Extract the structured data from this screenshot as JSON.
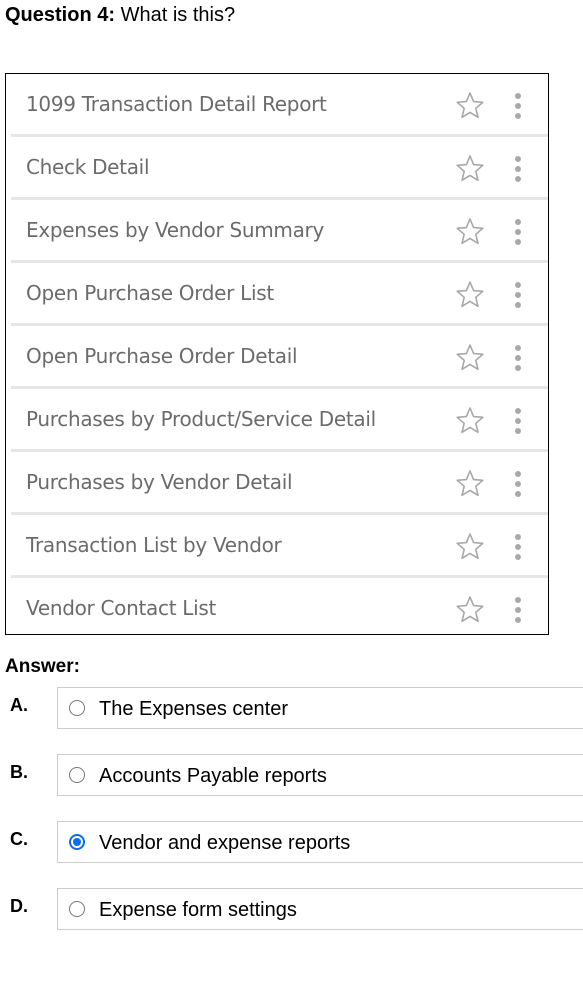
{
  "question": {
    "number_label": "Question 4:",
    "text": "What is this?"
  },
  "reports": [
    {
      "label": "1099 Transaction Detail Report",
      "icons": [
        "star-icon",
        "kebab-menu-icon"
      ]
    },
    {
      "label": "Check Detail",
      "icons": [
        "star-icon",
        "kebab-menu-icon"
      ]
    },
    {
      "label": "Expenses by Vendor Summary",
      "icons": [
        "star-icon",
        "kebab-menu-icon"
      ]
    },
    {
      "label": "Open Purchase Order List",
      "icons": [
        "star-icon",
        "kebab-menu-icon"
      ]
    },
    {
      "label": "Open Purchase Order Detail",
      "icons": [
        "star-icon",
        "kebab-menu-icon"
      ]
    },
    {
      "label": "Purchases by Product/Service Detail",
      "icons": [
        "star-icon",
        "kebab-menu-icon"
      ]
    },
    {
      "label": "Purchases by Vendor Detail",
      "icons": [
        "star-icon",
        "kebab-menu-icon"
      ]
    },
    {
      "label": "Transaction List by Vendor",
      "icons": [
        "star-icon",
        "kebab-menu-icon"
      ]
    },
    {
      "label": "Vendor Contact List",
      "icons": [
        "star-icon",
        "kebab-menu-icon"
      ]
    }
  ],
  "answer": {
    "heading": "Answer:",
    "options": [
      {
        "letter": "A.",
        "label": "The Expenses center",
        "selected": false
      },
      {
        "letter": "B.",
        "label": "Accounts Payable reports",
        "selected": false
      },
      {
        "letter": "C.",
        "label": "Vendor and expense reports",
        "selected": true
      },
      {
        "letter": "D.",
        "label": "Expense form settings",
        "selected": false
      }
    ]
  },
  "colors": {
    "radio_selected": "#0a6cf5",
    "report_text": "#6b6b6b",
    "row_divider": "#e6e6e6",
    "icon_gray": "#a8a8a8"
  }
}
